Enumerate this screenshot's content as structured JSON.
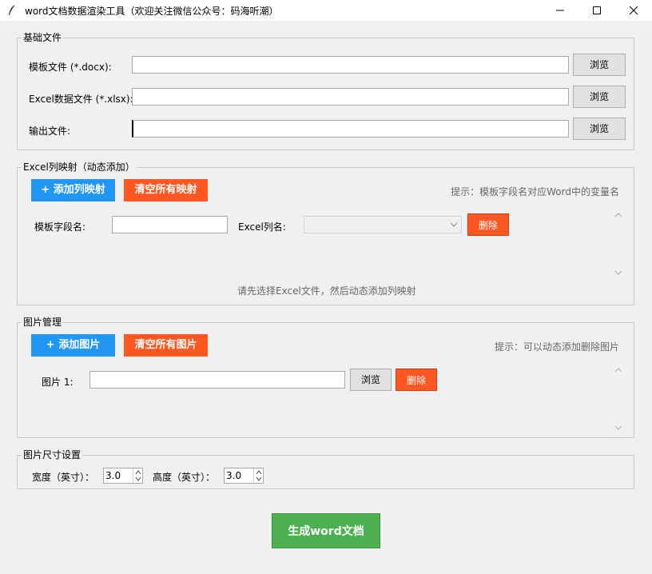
{
  "window": {
    "title": "word文档数据渲染工具（欢迎关注微信公众号：码海听潮）"
  },
  "basic_files": {
    "group_label": "基础文件",
    "template_label": "模板文件 (*.docx):",
    "template_value": "",
    "excel_label": "Excel数据文件 (*.xlsx):",
    "excel_value": "",
    "output_label": "输出文件:",
    "output_value": "",
    "browse_label": "浏览"
  },
  "mapping": {
    "group_label": "Excel列映射（动态添加）",
    "add_button": "+ 添加列映射",
    "clear_button": "清空所有映射",
    "hint": "提示：模板字段名对应Word中的变量名",
    "field_label": "模板字段名:",
    "field_value": "",
    "column_label": "Excel列名:",
    "column_value": "",
    "delete_button": "删除",
    "footer_hint": "请先选择Excel文件，然后动态添加列映射"
  },
  "images": {
    "group_label": "图片管理",
    "add_button": "+ 添加图片",
    "clear_button": "清空所有图片",
    "hint": "提示：可以动态添加删除图片",
    "image1_label": "图片 1:",
    "image1_value": "",
    "browse_label": "浏览",
    "delete_button": "删除"
  },
  "size": {
    "group_label": "图片尺寸设置",
    "width_label": "宽度（英寸）：",
    "width_value": "3.0",
    "height_label": "高度（英寸）：",
    "height_value": "3.0"
  },
  "generate_button": "生成word文档",
  "colors": {
    "blue": "#2196f3",
    "orange": "#ff5722",
    "green": "#4caf50"
  }
}
